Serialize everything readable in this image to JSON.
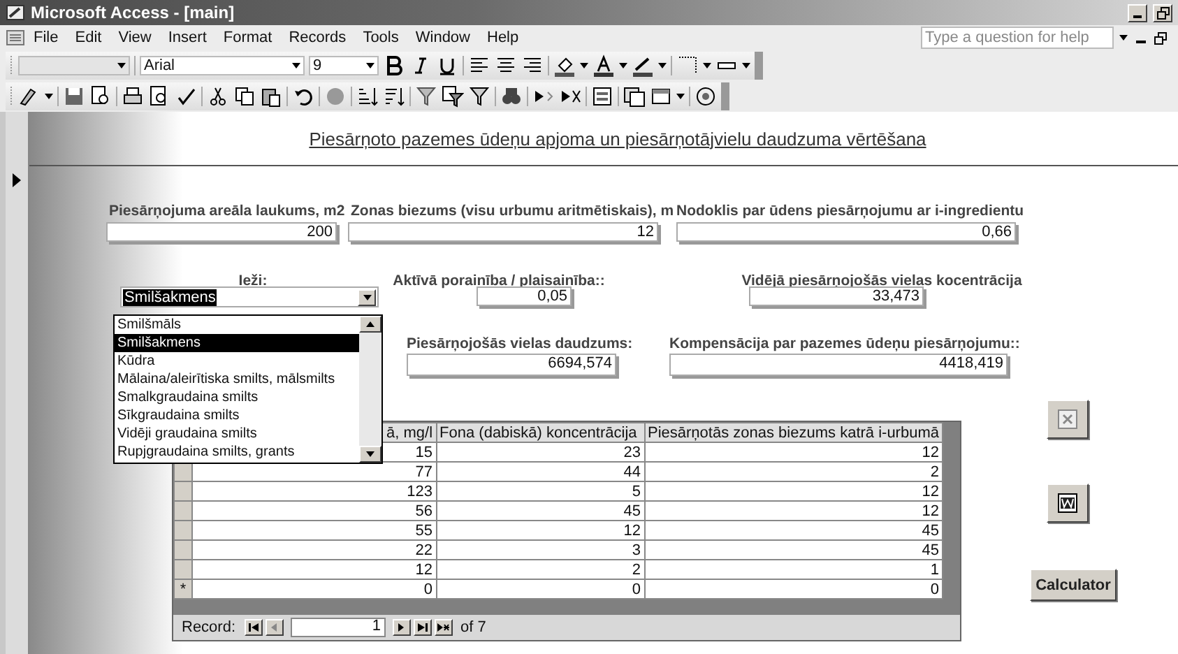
{
  "window": {
    "title": "Microsoft Access - [main]"
  },
  "menu": [
    "File",
    "Edit",
    "View",
    "Insert",
    "Format",
    "Records",
    "Tools",
    "Window",
    "Help"
  ],
  "help_box": {
    "placeholder": "Type a question for help"
  },
  "format_toolbar": {
    "font": "Arial",
    "size": "9"
  },
  "form": {
    "title": "Piesārņoto pazemes ūdeņu apjoma un piesārņotājvielu daudzuma vērtēšana",
    "fields": [
      {
        "label": "Piesārņojuma areāla laukums, m2",
        "value": "200",
        "kind": "text"
      },
      {
        "label": "Zonas biezums (visu urbumu aritmētiskais), m",
        "value": "12",
        "kind": "text"
      },
      {
        "label": "Nodoklis par ūdens piesārņojumu ar i-ingredientu",
        "value": "0,66",
        "kind": "text"
      },
      {
        "label": "Ieži:",
        "value": "Smilšakmens",
        "kind": "combo"
      },
      {
        "label": "Aktīvā porainība / plaisainība::",
        "value": "0,05",
        "kind": "text"
      },
      {
        "label": "Vidējā piesārņojošās vielas kocentrācija",
        "value": "33,473",
        "kind": "text"
      },
      {
        "label": "Piesārņojošās vielas daudzums:",
        "value": "6694,574",
        "kind": "text"
      },
      {
        "label": "Kompensācija par pazemes ūdeņu piesārņojumu::",
        "value": "4418,419",
        "kind": "text"
      }
    ],
    "dropdown": {
      "open": true,
      "options": [
        {
          "label": "Smilšmāls",
          "selected": false
        },
        {
          "label": "Smilšakmens",
          "selected": true
        },
        {
          "label": "Kūdra",
          "selected": false
        },
        {
          "label": "Mālaina/aleirītiska smilts, mālsmilts",
          "selected": false
        },
        {
          "label": "Smalkgraudaina smilts",
          "selected": false
        },
        {
          "label": "Sīkgraudaina smilts",
          "selected": false
        },
        {
          "label": "Vidēji graudaina smilts",
          "selected": false
        },
        {
          "label": "Rupjgraudaina smilts, grants",
          "selected": false
        }
      ]
    },
    "datasheet": {
      "columns": [
        "ā, mg/l",
        "Fona (dabiskā) koncentrācija",
        "Piesārņotās zonas biezums katrā i-urbumā"
      ],
      "rows": [
        [
          "15",
          "23",
          "12"
        ],
        [
          "77",
          "44",
          "2"
        ],
        [
          "123",
          "5",
          "12"
        ],
        [
          "56",
          "45",
          "12"
        ],
        [
          "55",
          "12",
          "45"
        ],
        [
          "22",
          "3",
          "45"
        ],
        [
          "12",
          "2",
          "1"
        ]
      ],
      "new_row": {
        "marker": "*",
        "values": [
          "0",
          "0",
          "0"
        ]
      },
      "navigation": {
        "label": "Record:",
        "current": "1",
        "total": "of 7"
      }
    },
    "buttons": [
      {
        "kind": "excel"
      },
      {
        "kind": "word"
      },
      {
        "kind": "text",
        "label": "Calculator"
      }
    ]
  }
}
